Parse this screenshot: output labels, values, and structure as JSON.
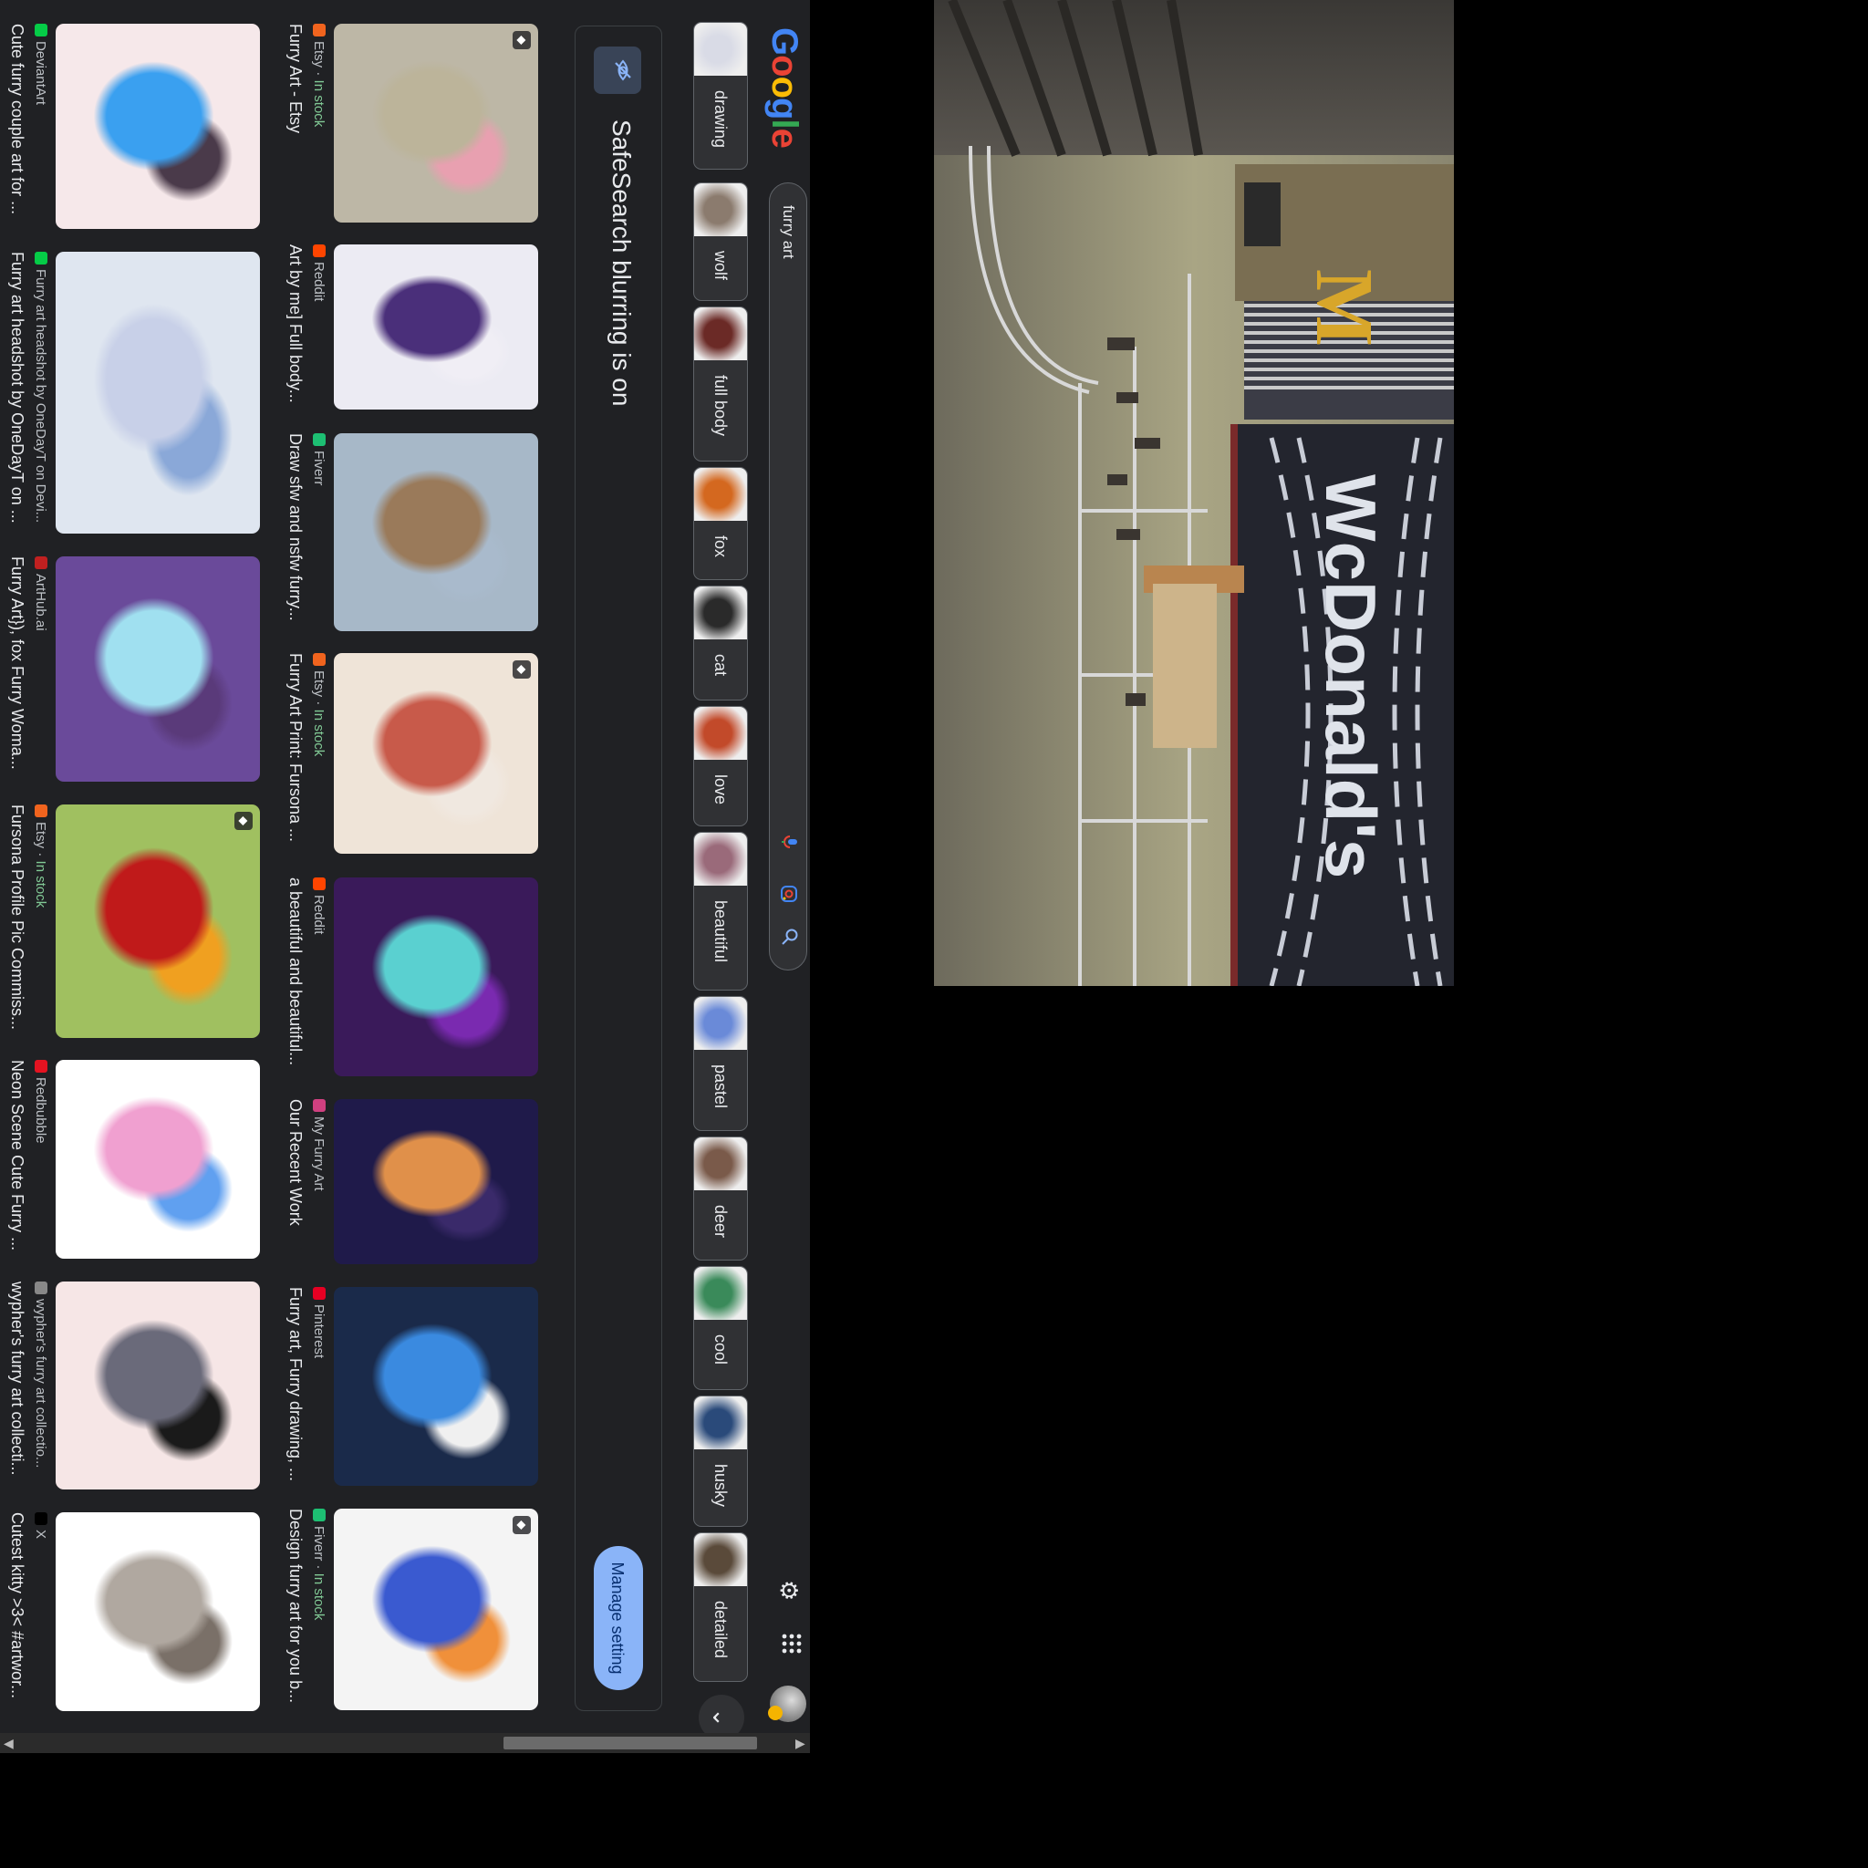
{
  "search": {
    "query": "furry art",
    "logo_letters": [
      "G",
      "o",
      "o",
      "g",
      "l",
      "e"
    ],
    "logo_colors": [
      "#4285f4",
      "#ea4335",
      "#fbbc05",
      "#4285f4",
      "#34a853",
      "#ea4335"
    ]
  },
  "chips": [
    {
      "label": "drawing",
      "thumb": "#d9dbe6"
    },
    {
      "label": "wolf",
      "thumb": "#8b7b6e"
    },
    {
      "label": "full body",
      "thumb": "#6b2a26"
    },
    {
      "label": "fox",
      "thumb": "#d4681f"
    },
    {
      "label": "cat",
      "thumb": "#2a2a2a"
    },
    {
      "label": "love",
      "thumb": "#c24a2a"
    },
    {
      "label": "beautiful",
      "thumb": "#9a6a7a"
    },
    {
      "label": "pastel",
      "thumb": "#6a8ad8"
    },
    {
      "label": "deer",
      "thumb": "#7a5a4a"
    },
    {
      "label": "cool",
      "thumb": "#3a8a5a"
    },
    {
      "label": "husky",
      "thumb": "#2a4a7a"
    },
    {
      "label": "detailed",
      "thumb": "#5a4a3a"
    }
  ],
  "safesearch": {
    "message": "SafeSearch blurring is on",
    "button": "Manage setting"
  },
  "row1": [
    {
      "source": "Etsy",
      "stock": "In stock",
      "title": "Furry Art - Etsy",
      "fav": "#f1641e",
      "c1": "#bcb49a",
      "c2": "#e8a0b0",
      "bg": "#bdb7a6",
      "badge": true
    },
    {
      "source": "Reddit",
      "stock": "",
      "title": "Art by me] Full body...",
      "fav": "#ff4500",
      "c1": "#4a2f7a",
      "c2": "#f0eef5",
      "bg": "#ecebf3",
      "badge": false
    },
    {
      "source": "Fiverr",
      "stock": "",
      "title": "Draw sfw and nsfw furry...",
      "fav": "#1dbf73",
      "c1": "#9a7a5a",
      "c2": "#a9bacc",
      "bg": "#a7b8c8",
      "badge": false
    },
    {
      "source": "Etsy",
      "stock": "In stock",
      "title": "Furry Art Print: Fursona ...",
      "fav": "#f1641e",
      "c1": "#c85a4a",
      "c2": "#f0e8e0",
      "bg": "#efe4d8",
      "badge": true
    },
    {
      "source": "Reddit",
      "stock": "",
      "title": "a beautiful and beautiful...",
      "fav": "#ff4500",
      "c1": "#5ad0d0",
      "c2": "#7a2ab0",
      "bg": "#3a1a5a",
      "badge": false
    },
    {
      "source": "My Furry Art",
      "stock": "",
      "title": "Our Recent Work",
      "fav": "#d04080",
      "c1": "#e0904a",
      "c2": "#3a2a6a",
      "bg": "#1f1a4a",
      "badge": false
    },
    {
      "source": "Pinterest",
      "stock": "",
      "title": "Furry art, Furry drawing, ...",
      "fav": "#e60023",
      "c1": "#3a8ae0",
      "c2": "#f0f0f0",
      "bg": "#1a2a4a",
      "badge": false
    },
    {
      "source": "Fiverr",
      "stock": "In stock",
      "title": "Design furry art for you b...",
      "fav": "#1dbf73",
      "c1": "#3a5ad0",
      "c2": "#f0903a",
      "bg": "#f4f4f4",
      "badge": true
    }
  ],
  "row2": [
    {
      "source": "DeviantArt",
      "stock": "",
      "title": "Cute furry couple art for ...",
      "fav": "#05cc47",
      "c1": "#3aa0f0",
      "c2": "#4a3a4a",
      "bg": "#f6e8ea",
      "badge": false
    },
    {
      "source": "Furry art headshot by OneDayT on Devi...",
      "stock": "",
      "title": "Furry art headshot by OneDayT on ...",
      "fav": "#05cc47",
      "c1": "#c8d0e8",
      "c2": "#8aa8d8",
      "bg": "#dfe6f0",
      "badge": false
    },
    {
      "source": "ArtHub.ai",
      "stock": "",
      "title": "Furry Art}), fox Furry Woma...",
      "fav": "#c02020",
      "c1": "#a0e0f0",
      "c2": "#5a3a7a",
      "bg": "#6a4a9a",
      "badge": false
    },
    {
      "source": "Etsy",
      "stock": "In stock",
      "title": "Fursona Profile Pic Commiss...",
      "fav": "#f1641e",
      "c1": "#c01a1a",
      "c2": "#f0a020",
      "bg": "#a0c060",
      "badge": true
    },
    {
      "source": "Redbubble",
      "stock": "",
      "title": "Neon Scene Cute Furry ...",
      "fav": "#e41321",
      "c1": "#f0a0d0",
      "c2": "#60a0f0",
      "bg": "#ffffff",
      "badge": false
    },
    {
      "source": "wypher's furry art collectio...",
      "stock": "",
      "title": "wypher's furry art collecti...",
      "fav": "#888888",
      "c1": "#6a6a7a",
      "c2": "#1a1a1a",
      "bg": "#f6e6e6",
      "badge": false
    },
    {
      "source": "X",
      "stock": "",
      "title": "Cutest kitty >3< #artwor...",
      "fav": "#000000",
      "c1": "#b0a8a0",
      "c2": "#7a7068",
      "bg": "#ffffff",
      "badge": false
    }
  ],
  "photo": {
    "sign_text": "WcDonald's",
    "sign_color": "#dfe3ea"
  }
}
